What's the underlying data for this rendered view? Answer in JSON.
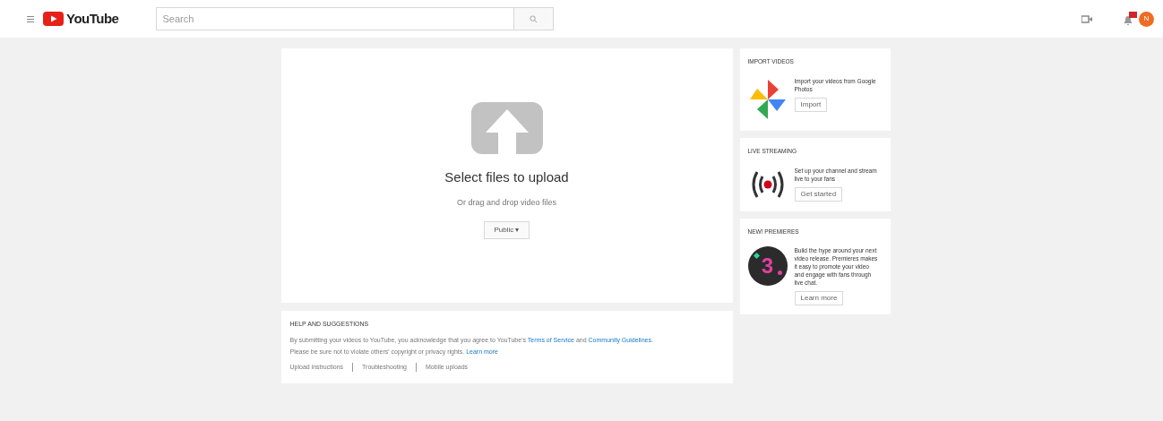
{
  "header": {
    "logo": "YouTube",
    "search": {
      "placeholder": "Search"
    },
    "avatar": "N"
  },
  "upload": {
    "title": "Select files to upload",
    "subtitle": "Or drag and drop video files",
    "privacy": "Public ▾"
  },
  "help": {
    "title": "HELP AND SUGGESTIONS",
    "lines": [
      [
        {
          "kind": "text",
          "text": "By submitting your videos to YouTube, you acknowledge that you agree to YouTube's "
        },
        {
          "kind": "link",
          "text": "Terms of Service"
        },
        {
          "kind": "text",
          "text": " and "
        },
        {
          "kind": "link",
          "text": "Community Guidelines"
        },
        {
          "kind": "text",
          "text": "."
        }
      ],
      [
        {
          "kind": "text",
          "text": "Please be sure not to violate others' copyright or privacy rights. "
        },
        {
          "kind": "link",
          "text": "Learn more"
        }
      ]
    ],
    "links": [
      "Upload instructions",
      "Troubleshooting",
      "Mobile uploads"
    ]
  },
  "side_cards": [
    {
      "kind": "photos",
      "title": "IMPORT VIDEOS",
      "text": "Import your videos from Google Photos",
      "button": "Import"
    },
    {
      "kind": "live",
      "title": "LIVE STREAMING",
      "text": "Set up your channel and stream live to your fans",
      "button": "Get started"
    },
    {
      "kind": "premiere",
      "title": "NEW! PREMIERES",
      "text": "Build the hype around your next video release. Premieres makes it easy to promote your video and engage with fans through live chat.",
      "button": "Learn more",
      "icon_text": "3"
    }
  ]
}
